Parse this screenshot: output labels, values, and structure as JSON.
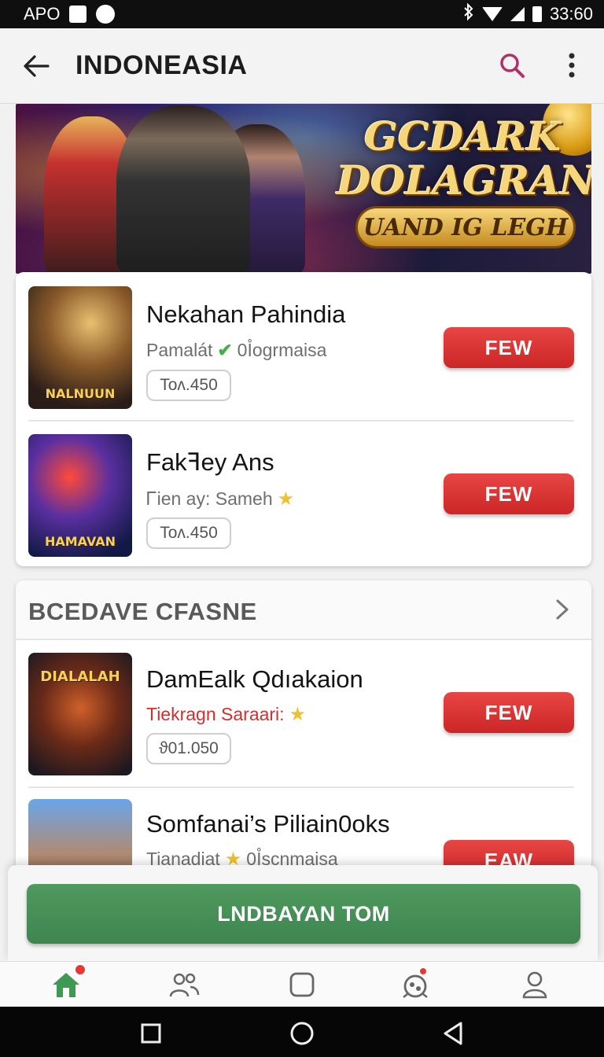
{
  "status_bar": {
    "carrier": "APO",
    "time": "33:60"
  },
  "app_bar": {
    "title": "INDONEASIA"
  },
  "banner": {
    "title_line1": "GCDARK",
    "title_line2": "DOLAGRAN",
    "subtitle": "UAND IG LEGH"
  },
  "featured": [
    {
      "title": "Nekahan Pahindia",
      "subtitle": "Pamalát",
      "subtitle_extra": "0I̊ogrmaisa",
      "price": "Toᴧ.450",
      "button": "FEW",
      "thumb_caption": "NALNUUN",
      "icon": "check-icon"
    },
    {
      "title": "Fakꟻey Ans",
      "subtitle": "Ꮁien ay: Sameh",
      "price": "Toᴧ.450",
      "button": "FEW",
      "thumb_caption": "HAMAVAN",
      "icon": "star-icon"
    }
  ],
  "section": {
    "title": "BCEDAVE CFASNE",
    "items": [
      {
        "title": "DamEalk Qdıakaion",
        "subtitle": "Tiekragn Saraari:",
        "price": "ϑ01.050",
        "button": "FEW",
        "thumb_caption": "DIALALAH",
        "icon": "star-icon"
      },
      {
        "title": "Somfanai’s Piliain0oks",
        "subtitle": "Tianadiat",
        "subtitle_extra": "0I̊scnmaisa",
        "price": "",
        "button": "EAW",
        "thumb_caption": "",
        "icon": "star-icon"
      }
    ]
  },
  "primary_action": {
    "label": "LNDBAYAN TOM"
  },
  "colors": {
    "accent_red": "#d32f2f",
    "primary_green": "#3e8550",
    "search_icon": "#b0306a"
  }
}
